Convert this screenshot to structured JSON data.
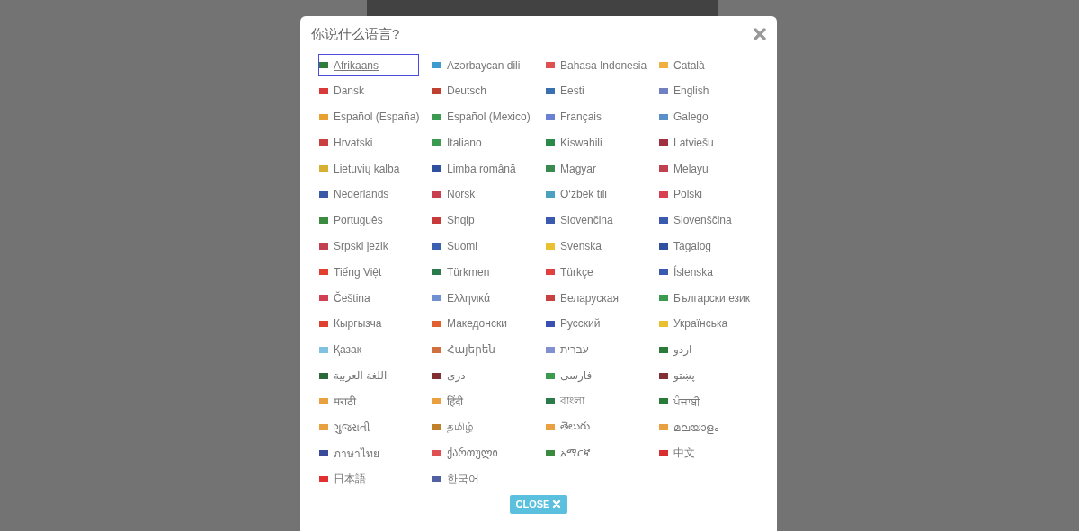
{
  "dialog": {
    "title": "你说什么语言?",
    "languages": [
      {
        "label": "Afrikaans",
        "color": "#2f7d3a",
        "selected": true
      },
      {
        "label": "Azərbaycan dili",
        "color": "#3f9ad0",
        "selected": false
      },
      {
        "label": "Bahasa Indonesia",
        "color": "#e05050",
        "selected": false
      },
      {
        "label": "Català",
        "color": "#f0b040",
        "selected": false
      },
      {
        "label": "Dansk",
        "color": "#d83a3a",
        "selected": false
      },
      {
        "label": "Deutsch",
        "color": "#c04030",
        "selected": false
      },
      {
        "label": "Eesti",
        "color": "#3a6fb0",
        "selected": false
      },
      {
        "label": "English",
        "color": "#7080c0",
        "selected": false
      },
      {
        "label": "Español (España)",
        "color": "#e8a030",
        "selected": false
      },
      {
        "label": "Español (Mexico)",
        "color": "#3a9a50",
        "selected": false
      },
      {
        "label": "Français",
        "color": "#6a80d0",
        "selected": false
      },
      {
        "label": "Galego",
        "color": "#5a90c8",
        "selected": false
      },
      {
        "label": "Hrvatski",
        "color": "#c84040",
        "selected": false
      },
      {
        "label": "Italiano",
        "color": "#3a9a50",
        "selected": false
      },
      {
        "label": "Kiswahili",
        "color": "#2a8a4a",
        "selected": false
      },
      {
        "label": "Latviešu",
        "color": "#a03040",
        "selected": false
      },
      {
        "label": "Lietuvių kalba",
        "color": "#d8b030",
        "selected": false
      },
      {
        "label": "Limba română",
        "color": "#3050a0",
        "selected": false
      },
      {
        "label": "Magyar",
        "color": "#3a8a50",
        "selected": false
      },
      {
        "label": "Melayu",
        "color": "#c04050",
        "selected": false
      },
      {
        "label": "Nederlands",
        "color": "#3a5aa8",
        "selected": false
      },
      {
        "label": "Norsk",
        "color": "#c84050",
        "selected": false
      },
      {
        "label": "O‘zbek tili",
        "color": "#4aa0c0",
        "selected": false
      },
      {
        "label": "Polski",
        "color": "#d84050",
        "selected": false
      },
      {
        "label": "Português",
        "color": "#3a8a40",
        "selected": false
      },
      {
        "label": "Shqip",
        "color": "#c83a3a",
        "selected": false
      },
      {
        "label": "Slovenčina",
        "color": "#3a5ab0",
        "selected": false
      },
      {
        "label": "Slovenščina",
        "color": "#3a5ab0",
        "selected": false
      },
      {
        "label": "Srpski jezik",
        "color": "#c04050",
        "selected": false
      },
      {
        "label": "Suomi",
        "color": "#3a60b0",
        "selected": false
      },
      {
        "label": "Svenska",
        "color": "#e8c030",
        "selected": false
      },
      {
        "label": "Tagalog",
        "color": "#3050a0",
        "selected": false
      },
      {
        "label": "Tiếng Việt",
        "color": "#e04030",
        "selected": false
      },
      {
        "label": "Türkmen",
        "color": "#2a7a4a",
        "selected": false
      },
      {
        "label": "Türkçe",
        "color": "#e04040",
        "selected": false
      },
      {
        "label": "Íslenska",
        "color": "#3a5ab0",
        "selected": false
      },
      {
        "label": "Čeština",
        "color": "#d04050",
        "selected": false
      },
      {
        "label": "Ελληνικά",
        "color": "#7090d0",
        "selected": false
      },
      {
        "label": "Беларуская",
        "color": "#c84040",
        "selected": false
      },
      {
        "label": "Български език",
        "color": "#3a9a50",
        "selected": false
      },
      {
        "label": "Кыргызча",
        "color": "#e04030",
        "selected": false
      },
      {
        "label": "Македонски",
        "color": "#e06030",
        "selected": false
      },
      {
        "label": "Русский",
        "color": "#3a50b0",
        "selected": false
      },
      {
        "label": "Українська",
        "color": "#e8c030",
        "selected": false
      },
      {
        "label": "Қазақ",
        "color": "#80c0e0",
        "selected": false
      },
      {
        "label": "Հայերեն",
        "color": "#d07040",
        "selected": false
      },
      {
        "label": "עברית",
        "color": "#8090d0",
        "selected": false
      },
      {
        "label": "اردو",
        "color": "#2a7a3a",
        "selected": false
      },
      {
        "label": "اللغة العربية",
        "color": "#2a6a3a",
        "selected": false
      },
      {
        "label": "دری",
        "color": "#803030",
        "selected": false
      },
      {
        "label": "فارسی",
        "color": "#3a9a50",
        "selected": false
      },
      {
        "label": "پښتو",
        "color": "#803030",
        "selected": false
      },
      {
        "label": "मराठी",
        "color": "#e8a040",
        "selected": false
      },
      {
        "label": "हिंदी",
        "color": "#e8a040",
        "selected": false
      },
      {
        "label": "বাংলা",
        "color": "#2a7a4a",
        "selected": false
      },
      {
        "label": "ਪੰਜਾਬੀ",
        "color": "#2a7a3a",
        "selected": false
      },
      {
        "label": "ગુજરાતી",
        "color": "#e8a040",
        "selected": false
      },
      {
        "label": "தமிழ்",
        "color": "#c0802a",
        "selected": false
      },
      {
        "label": "తెలుగు",
        "color": "#e8a040",
        "selected": false
      },
      {
        "label": "മലയാളം",
        "color": "#e8a040",
        "selected": false
      },
      {
        "label": "ภาษาไทย",
        "color": "#3a4a9a",
        "selected": false
      },
      {
        "label": "ქართული",
        "color": "#e05050",
        "selected": false
      },
      {
        "label": "አማርኛ",
        "color": "#3a8a40",
        "selected": false
      },
      {
        "label": "中文",
        "color": "#d83030",
        "selected": false
      },
      {
        "label": "日本語",
        "color": "#e03030",
        "selected": false
      },
      {
        "label": "한국어",
        "color": "#5060a0",
        "selected": false
      }
    ],
    "close_button": {
      "label": "CLOSE"
    }
  }
}
